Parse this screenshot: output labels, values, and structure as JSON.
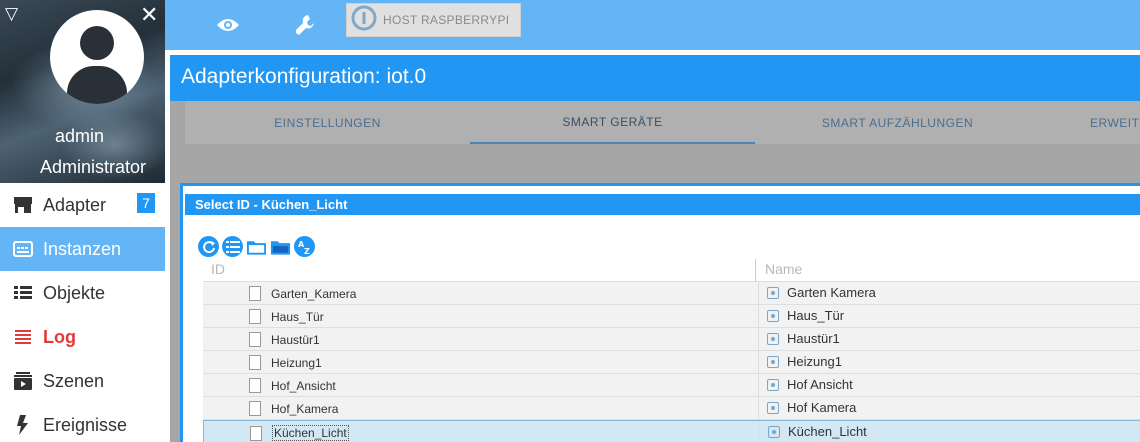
{
  "profile": {
    "user_name": "admin",
    "user_role": "Administrator"
  },
  "sidebar": {
    "items": [
      {
        "label": "Adapter",
        "icon": "store-icon",
        "badge": "7"
      },
      {
        "label": "Instanzen",
        "icon": "instances-icon",
        "active": true
      },
      {
        "label": "Objekte",
        "icon": "list-icon"
      },
      {
        "label": "Log",
        "icon": "log-icon"
      },
      {
        "label": "Szenen",
        "icon": "scenes-icon"
      },
      {
        "label": "Ereignisse",
        "icon": "lightning-icon"
      }
    ]
  },
  "topbar": {
    "host_label": "HOST RASPBERRYPI"
  },
  "main": {
    "title": "Adapterkonfiguration: iot.0",
    "tabs": [
      {
        "label": "EINSTELLUNGEN"
      },
      {
        "label": "SMART GERÄTE",
        "active": true
      },
      {
        "label": "SMART AUFZÄHLUNGEN"
      },
      {
        "label": "ERWEITE"
      }
    ]
  },
  "dialog": {
    "title": "Select ID - Küchen_Licht",
    "columns": {
      "id": "ID",
      "name": "Name"
    },
    "rows": [
      {
        "id": "Garten_Kamera",
        "name": "Garten Kamera"
      },
      {
        "id": "Haus_Tür",
        "name": "Haus_Tür"
      },
      {
        "id": "Haustür1",
        "name": "Haustür1"
      },
      {
        "id": "Heizung1",
        "name": "Heizung1"
      },
      {
        "id": "Hof_Ansicht",
        "name": "Hof Ansicht"
      },
      {
        "id": "Hof_Kamera",
        "name": "Hof Kamera"
      },
      {
        "id": "Küchen_Licht",
        "name": "Küchen_Licht",
        "selected": true
      }
    ]
  },
  "colors": {
    "primary": "#2196f3",
    "topbar": "#64b5f6",
    "log": "#e53935"
  }
}
